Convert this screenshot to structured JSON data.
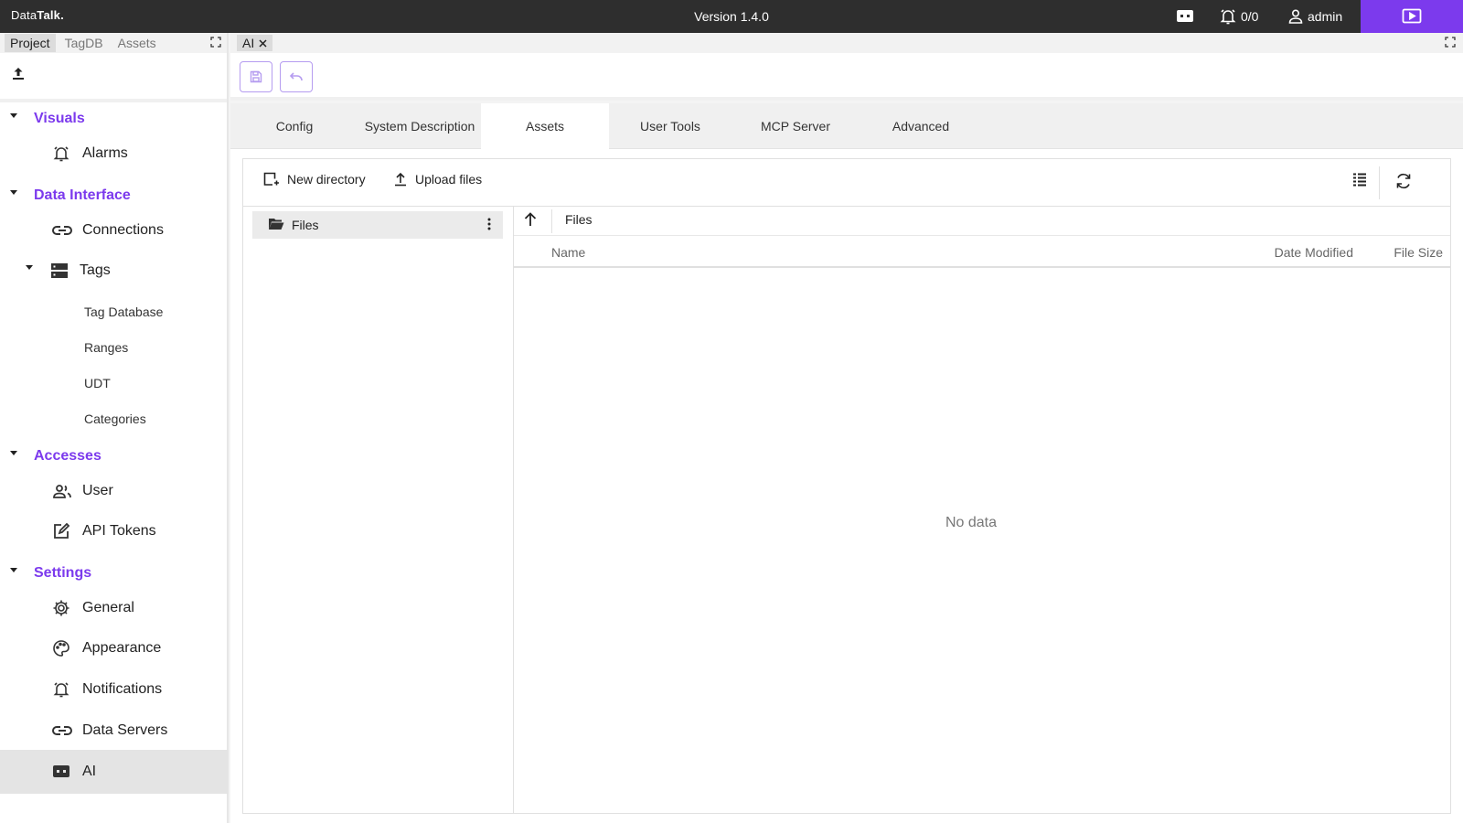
{
  "topbar": {
    "brand_part1": "Data",
    "brand_part2": "Talk.",
    "version": "Version 1.4.0",
    "alarm_count": "0/0",
    "user_name": "admin",
    "accent_color": "#7c3aed"
  },
  "left_panel": {
    "tabs": [
      "Project",
      "TagDB",
      "Assets"
    ],
    "active_tab": "Project",
    "sections": {
      "visuals": {
        "label": "Visuals",
        "items": [
          {
            "label": "Alarms",
            "icon": "alarm-bell-icon"
          }
        ]
      },
      "data_interface": {
        "label": "Data Interface",
        "items": [
          {
            "label": "Connections",
            "icon": "link-icon"
          },
          {
            "label": "Tags",
            "icon": "storage-icon"
          }
        ],
        "tag_subitems": [
          "Tag Database",
          "Ranges",
          "UDT",
          "Categories"
        ]
      },
      "accesses": {
        "label": "Accesses",
        "items": [
          {
            "label": "User",
            "icon": "users-icon"
          },
          {
            "label": "API Tokens",
            "icon": "edit-box-icon"
          }
        ]
      },
      "settings": {
        "label": "Settings",
        "items": [
          {
            "label": "General",
            "icon": "gear-icon"
          },
          {
            "label": "Appearance",
            "icon": "palette-icon"
          },
          {
            "label": "Notifications",
            "icon": "alarm-bell-icon"
          },
          {
            "label": "Data Servers",
            "icon": "link-icon"
          },
          {
            "label": "AI",
            "icon": "ai-chat-icon",
            "active": true
          }
        ]
      }
    }
  },
  "document": {
    "open_tab": "AI",
    "tabs": [
      "Config",
      "System Description",
      "Assets",
      "User Tools",
      "MCP Server",
      "Advanced"
    ],
    "active_tab": "Assets"
  },
  "file_manager": {
    "new_directory_label": "New directory",
    "upload_files_label": "Upload files",
    "tree_root": "Files",
    "current_path": "Files",
    "columns": [
      "Name",
      "Date Modified",
      "File Size"
    ],
    "empty_text": "No data"
  }
}
